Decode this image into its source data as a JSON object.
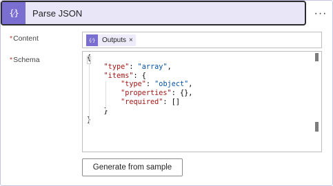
{
  "header": {
    "title": "Parse JSON",
    "icon": "braces-icon",
    "icon_glyph": "{⁄}",
    "more_label": "···"
  },
  "fields": {
    "content_label": "Content",
    "schema_label": "Schema",
    "required_marker": "*"
  },
  "content_token": {
    "label": "Outputs",
    "remove_label": "×",
    "icon_glyph": "{⁄}"
  },
  "schema_code": [
    "{",
    "    \"type\": \"array\",",
    "    \"items\": {",
    "        \"type\": \"object\",",
    "        \"properties\": {},",
    "        \"required\": []",
    "    }",
    "}"
  ],
  "buttons": {
    "generate_label": "Generate from sample"
  },
  "colors": {
    "accent": "#7a6fd0",
    "header_bg": "#e8e6f7",
    "json_key": "#a31515",
    "json_string": "#0451a5"
  }
}
